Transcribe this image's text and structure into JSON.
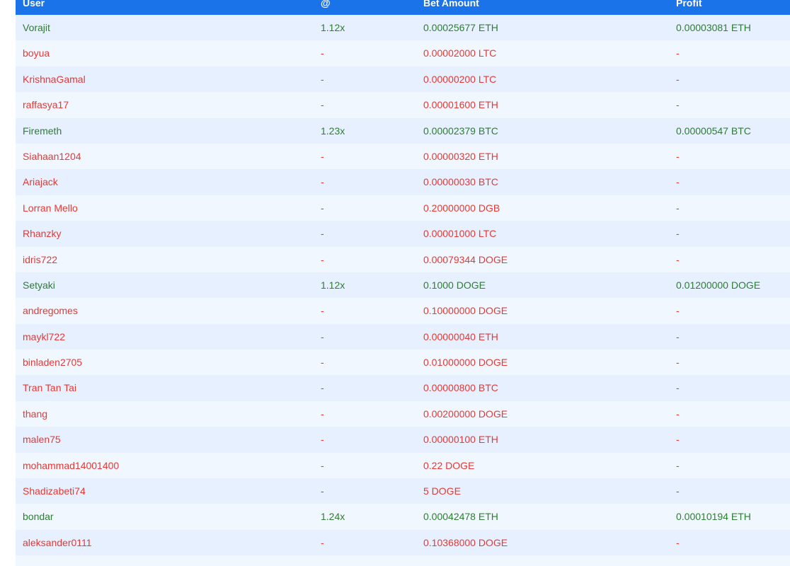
{
  "header": {
    "user": "User",
    "multiplier": "@",
    "bet_amount": "Bet Amount",
    "profit": "Profit"
  },
  "colors": {
    "header_bg": "#1a73e8",
    "win_text": "#2e7d32",
    "lose_text": "#e53935",
    "row_odd": "#e6f0fe",
    "row_even": "#f1f7fe"
  },
  "rows": [
    {
      "user": "Vorajit",
      "multiplier": "1.12x",
      "bet": "0.00025677 ETH",
      "profit": "0.00003081 ETH",
      "status": "win"
    },
    {
      "user": "boyua",
      "multiplier": "-",
      "bet": "0.00002000 LTC",
      "profit": "-",
      "status": "lose"
    },
    {
      "user": "KrishnaGamal",
      "multiplier": "-",
      "bet": "0.00000200 LTC",
      "profit": "-",
      "status": "lose"
    },
    {
      "user": "raffasya17",
      "multiplier": "-",
      "bet": "0.00001600 ETH",
      "profit": "-",
      "status": "lose"
    },
    {
      "user": "Firemeth",
      "multiplier": "1.23x",
      "bet": "0.00002379 BTC",
      "profit": "0.00000547 BTC",
      "status": "win"
    },
    {
      "user": "Siahaan1204",
      "multiplier": "-",
      "bet": "0.00000320 ETH",
      "profit": "-",
      "status": "lose"
    },
    {
      "user": "Ariajack",
      "multiplier": "-",
      "bet": "0.00000030 BTC",
      "profit": "-",
      "status": "lose"
    },
    {
      "user": "Lorran Mello",
      "multiplier": "-",
      "bet": "0.20000000 DGB",
      "profit": "-",
      "status": "lose"
    },
    {
      "user": "Rhanzky",
      "multiplier": "-",
      "bet": "0.00001000 LTC",
      "profit": "-",
      "status": "lose"
    },
    {
      "user": "idris722",
      "multiplier": "-",
      "bet": "0.00079344 DOGE",
      "profit": "-",
      "status": "lose"
    },
    {
      "user": "Setyaki",
      "multiplier": "1.12x",
      "bet": "0.1000 DOGE",
      "profit": "0.01200000 DOGE",
      "status": "win"
    },
    {
      "user": "andregomes",
      "multiplier": "-",
      "bet": "0.10000000 DOGE",
      "profit": "-",
      "status": "lose"
    },
    {
      "user": "maykl722",
      "multiplier": "-",
      "bet": "0.00000040 ETH",
      "profit": "-",
      "status": "lose"
    },
    {
      "user": "binladen2705",
      "multiplier": "-",
      "bet": "0.01000000 DOGE",
      "profit": "-",
      "status": "lose"
    },
    {
      "user": "Tran Tan Tai",
      "multiplier": "-",
      "bet": "0.00000800 BTC",
      "profit": "-",
      "status": "lose"
    },
    {
      "user": "thang",
      "multiplier": "-",
      "bet": "0.00200000 DOGE",
      "profit": "-",
      "status": "lose"
    },
    {
      "user": "malen75",
      "multiplier": "-",
      "bet": "0.00000100 ETH",
      "profit": "-",
      "status": "lose"
    },
    {
      "user": "mohammad14001400",
      "multiplier": "-",
      "bet": "0.22 DOGE",
      "profit": "-",
      "status": "lose"
    },
    {
      "user": "Shadizabeti74",
      "multiplier": "-",
      "bet": "5 DOGE",
      "profit": "-",
      "status": "lose"
    },
    {
      "user": "bondar",
      "multiplier": "1.24x",
      "bet": "0.00042478 ETH",
      "profit": "0.00010194 ETH",
      "status": "win"
    },
    {
      "user": "aleksander0111",
      "multiplier": "-",
      "bet": "0.10368000 DOGE",
      "profit": "-",
      "status": "lose"
    },
    {
      "user": "",
      "multiplier": "",
      "bet": "",
      "profit": "",
      "status": "lose"
    }
  ]
}
